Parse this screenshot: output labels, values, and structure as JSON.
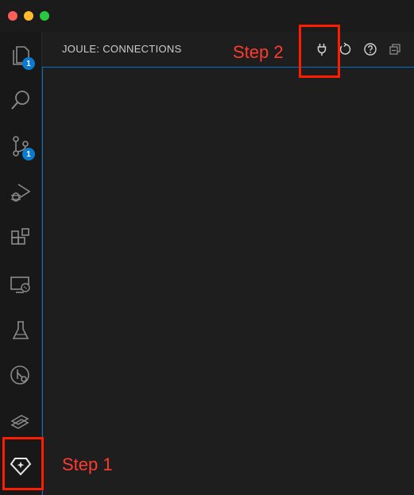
{
  "window": {
    "traffic_lights": {
      "close": "#fe5f57",
      "minimize": "#febc2e",
      "zoom": "#28c840"
    }
  },
  "activity_bar": {
    "items": [
      {
        "name": "explorer",
        "icon": "files-icon",
        "badge": "1"
      },
      {
        "name": "search",
        "icon": "search-icon"
      },
      {
        "name": "source-control",
        "icon": "source-control-icon",
        "badge": "1"
      },
      {
        "name": "run-and-debug",
        "icon": "run-debug-icon"
      },
      {
        "name": "extensions",
        "icon": "extensions-icon"
      },
      {
        "name": "remote-explorer",
        "icon": "remote-explorer-icon"
      },
      {
        "name": "testing",
        "icon": "beaker-icon"
      },
      {
        "name": "git-graph",
        "icon": "git-graph-icon"
      },
      {
        "name": "layers",
        "icon": "layers-icon"
      },
      {
        "name": "joule",
        "icon": "joule-diamond-icon"
      }
    ]
  },
  "panel": {
    "title": "JOULE: CONNECTIONS",
    "actions": [
      {
        "name": "connect",
        "icon": "plug-icon"
      },
      {
        "name": "refresh",
        "icon": "refresh-icon"
      },
      {
        "name": "help",
        "icon": "help-icon"
      },
      {
        "name": "collapse-all",
        "icon": "collapse-all-icon"
      }
    ]
  },
  "annotations": {
    "step1": "Step 1",
    "step2": "Step 2",
    "highlight_color": "#ff1d00"
  }
}
